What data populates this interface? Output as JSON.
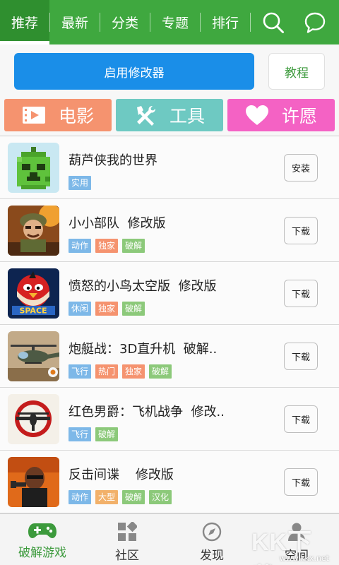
{
  "top_nav": {
    "tabs": [
      {
        "label": "推荐",
        "active": true
      },
      {
        "label": "最新"
      },
      {
        "label": "分类"
      },
      {
        "label": "专题"
      },
      {
        "label": "排行"
      }
    ],
    "search_icon": "search-icon",
    "chat_icon": "chat-bubble-icon",
    "color": "#3fa83f"
  },
  "actions": {
    "primary_label": "启用修改器",
    "tutorial_label": "教程",
    "primary_color": "#1a8ee8"
  },
  "categories": [
    {
      "label": "电影",
      "icon": "film-icon",
      "color": "#f5936f"
    },
    {
      "label": "工具",
      "icon": "tools-icon",
      "color": "#6ec9c2"
    },
    {
      "label": "许愿",
      "icon": "heart-icon",
      "color": "#f462c4"
    }
  ],
  "apps": [
    {
      "title": "葫芦侠我的世界",
      "tags": [
        "实用"
      ],
      "button": "安装",
      "icon": "gourd-pixel-icon"
    },
    {
      "title": "小小部队  修改版",
      "tags": [
        "动作",
        "独家",
        "破解"
      ],
      "button": "下载",
      "icon": "soldier-icon"
    },
    {
      "title": "愤怒的小鸟太空版  修改版",
      "tags": [
        "休闲",
        "独家",
        "破解"
      ],
      "button": "下载",
      "icon": "angry-bird-space-icon"
    },
    {
      "title": "炮艇战：3D直升机  破解..",
      "tags": [
        "飞行",
        "热门",
        "独家",
        "破解"
      ],
      "button": "下载",
      "icon": "helicopter-icon"
    },
    {
      "title": "红色男爵：飞机战争  修改..",
      "tags": [
        "飞行",
        "破解"
      ],
      "button": "下载",
      "icon": "red-baron-plane-icon"
    },
    {
      "title": "反击间谍    修改版",
      "tags": [
        "动作",
        "大型",
        "破解",
        "汉化"
      ],
      "button": "下载",
      "icon": "spy-icon"
    }
  ],
  "tag_colors": {
    "实用": "#7db8e8",
    "动作": "#7db8e8",
    "休闲": "#7db8e8",
    "飞行": "#7db8e8",
    "独家": "#f5936f",
    "热门": "#f5936f",
    "大型": "#f2b16a",
    "破解": "#8cc97a",
    "汉化": "#8cc97a"
  },
  "bottom_nav": [
    {
      "label": "破解游戏",
      "icon": "gamepad-icon",
      "active": true
    },
    {
      "label": "社区",
      "icon": "grid-icon"
    },
    {
      "label": "发现",
      "icon": "compass-icon"
    },
    {
      "label": "空间",
      "icon": "user-icon"
    }
  ],
  "watermark": {
    "logo_text": "KK下载",
    "url": "www.kkx.net"
  }
}
